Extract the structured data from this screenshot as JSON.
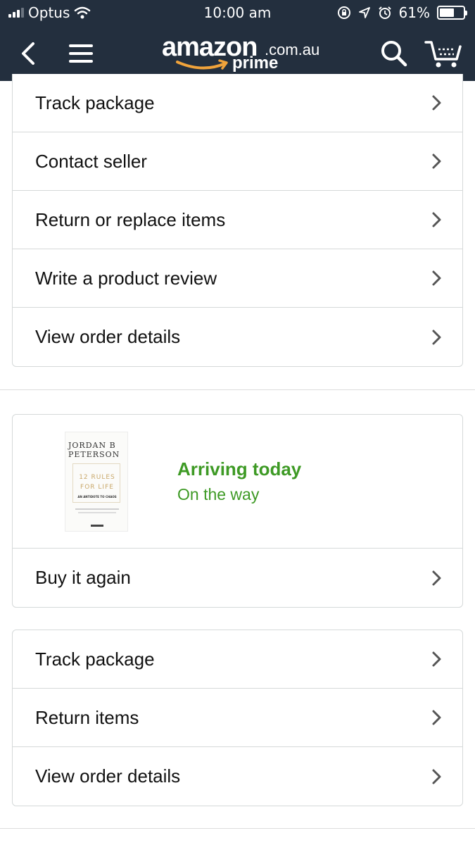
{
  "status_bar": {
    "carrier": "Optus",
    "time": "10:00 am",
    "battery_text": "61%",
    "battery_level": 0.61
  },
  "nav": {
    "logo_word": "amazon",
    "logo_domain": ".com.au",
    "logo_prime": "prime",
    "icons": [
      "back-icon",
      "menu-icon",
      "search-icon",
      "cart-icon"
    ]
  },
  "top_actions": [
    {
      "label": "Track package"
    },
    {
      "label": "Contact seller"
    },
    {
      "label": "Return or replace items"
    },
    {
      "label": "Write a product review"
    },
    {
      "label": "View order details"
    }
  ],
  "shipment": {
    "book": {
      "author_line1": "JORDAN B",
      "author_line2": "PETERSON",
      "title_line1": "12 RULES",
      "title_line2": "FOR LIFE",
      "subtitle": "AN ANTIDOTE TO CHAOS"
    },
    "status": "Arriving today",
    "substatus": "On the way",
    "buy_again_label": "Buy it again"
  },
  "bottom_actions": [
    {
      "label": "Track package"
    },
    {
      "label": "Return items"
    },
    {
      "label": "View order details"
    }
  ],
  "colors": {
    "header_bg": "#232f3e",
    "status_green": "#3e9a25",
    "smile_orange": "#f0a33b",
    "border": "#d5d9d9"
  }
}
